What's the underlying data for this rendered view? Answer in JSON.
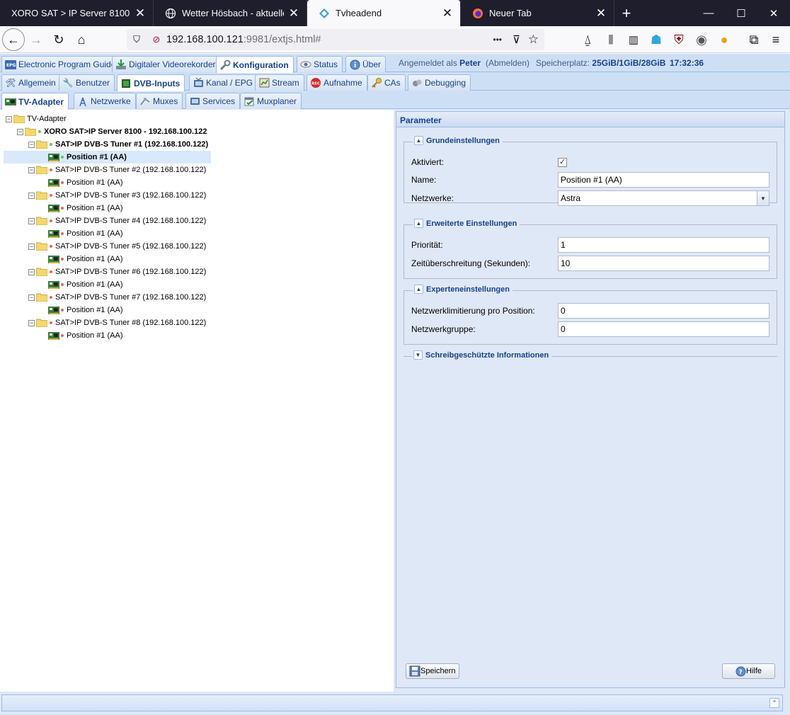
{
  "browser": {
    "tabs": [
      {
        "title": "XORO SAT > IP Server 8100 - Front",
        "close": "✕"
      },
      {
        "title": "Wetter Hösbach - aktuelle Wetter",
        "close": "✕"
      },
      {
        "title": "Tvheadend",
        "close": "✕"
      },
      {
        "title": "Neuer Tab",
        "close": "✕"
      }
    ],
    "url_host": "192.168.100.121",
    "url_rest": ":9981/extjs.html#",
    "url_more": "•••"
  },
  "main_tabs": [
    {
      "label": "Electronic Program Guide",
      "icon": "epg-icon"
    },
    {
      "label": "Digitaler Videorekorder",
      "icon": "download-icon"
    },
    {
      "label": "Konfiguration",
      "icon": "wrench-icon"
    },
    {
      "label": "Status",
      "icon": "eye-icon"
    },
    {
      "label": "Über",
      "icon": "info-icon"
    }
  ],
  "userinfo": {
    "logged_in_prefix": "Angemeldet als",
    "user": "Peter",
    "logout": "(Abmelden)",
    "storage_label": "Speicherplatz:",
    "storage_value": "25GiB/1GiB/28GiB",
    "time": "17:32:36"
  },
  "config_tabs": [
    {
      "label": "Allgemein"
    },
    {
      "label": "Benutzer"
    },
    {
      "label": "DVB-Inputs"
    },
    {
      "label": "Kanal / EPG"
    },
    {
      "label": "Stream"
    },
    {
      "label": "Aufnahme"
    },
    {
      "label": "CAs"
    },
    {
      "label": "Debugging"
    }
  ],
  "dvb_tabs": [
    {
      "label": "TV-Adapter"
    },
    {
      "label": "Netzwerke"
    },
    {
      "label": "Muxes"
    },
    {
      "label": "Services"
    },
    {
      "label": "Muxplaner"
    }
  ],
  "tree": {
    "root": "TV-Adapter",
    "server": "XORO SAT>IP Server 8100 - 192.168.100.122",
    "tuners": [
      {
        "label": "SAT>IP DVB-S Tuner #1 (192.168.100.122)",
        "position": "Position #1 (AA)",
        "status": "green"
      },
      {
        "label": "SAT>IP DVB-S Tuner #2 (192.168.100.122)",
        "position": "Position #1 (AA)",
        "status": "red"
      },
      {
        "label": "SAT>IP DVB-S Tuner #3 (192.168.100.122)",
        "position": "Position #1 (AA)",
        "status": "red"
      },
      {
        "label": "SAT>IP DVB-S Tuner #4 (192.168.100.122)",
        "position": "Position #1 (AA)",
        "status": "red"
      },
      {
        "label": "SAT>IP DVB-S Tuner #5 (192.168.100.122)",
        "position": "Position #1 (AA)",
        "status": "red"
      },
      {
        "label": "SAT>IP DVB-S Tuner #6 (192.168.100.122)",
        "position": "Position #1 (AA)",
        "status": "red"
      },
      {
        "label": "SAT>IP DVB-S Tuner #7 (192.168.100.122)",
        "position": "Position #1 (AA)",
        "status": "red"
      },
      {
        "label": "SAT>IP DVB-S Tuner #8 (192.168.100.122)",
        "position": "Position #1 (AA)",
        "status": "red"
      }
    ]
  },
  "params": {
    "title": "Parameter",
    "grund": {
      "legend": "Grundeinstellungen",
      "enabled_label": "Aktiviert:",
      "enabled_mark": "✓",
      "name_label": "Name:",
      "name_value": "Position #1 (AA)",
      "net_label": "Netzwerke:",
      "net_value": "Astra"
    },
    "erweitert": {
      "legend": "Erweiterte Einstellungen",
      "prio_label": "Priorität:",
      "prio_value": "1",
      "timeout_label": "Zeitüberschreitung (Sekunden):",
      "timeout_value": "10"
    },
    "experte": {
      "legend": "Experteneinstellungen",
      "netlimit_label": "Netzwerklimitierung pro Position:",
      "netlimit_value": "0",
      "netgroup_label": "Netzwerkgruppe:",
      "netgroup_value": "0"
    },
    "readonly": {
      "legend": "Schreibgeschützte Informationen"
    },
    "save_label": "Speichern",
    "help_label": "Hilfe"
  },
  "colors": {
    "header_text": "#15428b",
    "panel_bg": "#dfe8f6",
    "active_green": "#5fc65f",
    "inactive_red": "#e46666"
  }
}
